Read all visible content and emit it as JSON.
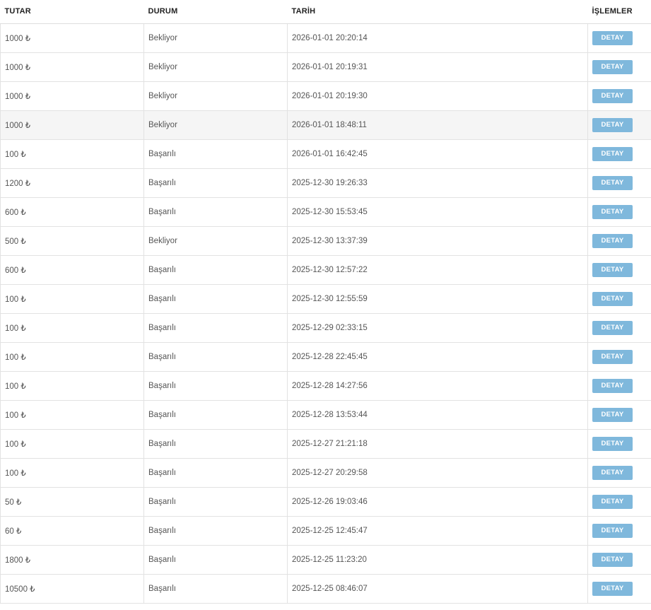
{
  "table": {
    "headers": [
      "TUTAR",
      "DURUM",
      "TARİH",
      "İŞLEMLER"
    ],
    "action_label": "DETAY",
    "highlighted_row": 3,
    "rows": [
      {
        "amount": "1000 ₺",
        "status": "Bekliyor",
        "date": "2026-01-01 20:20:14"
      },
      {
        "amount": "1000 ₺",
        "status": "Bekliyor",
        "date": "2026-01-01 20:19:31"
      },
      {
        "amount": "1000 ₺",
        "status": "Bekliyor",
        "date": "2026-01-01 20:19:30"
      },
      {
        "amount": "1000 ₺",
        "status": "Bekliyor",
        "date": "2026-01-01 18:48:11"
      },
      {
        "amount": "100 ₺",
        "status": "Başarılı",
        "date": "2026-01-01 16:42:45"
      },
      {
        "amount": "1200 ₺",
        "status": "Başarılı",
        "date": "2025-12-30 19:26:33"
      },
      {
        "amount": "600 ₺",
        "status": "Başarılı",
        "date": "2025-12-30 15:53:45"
      },
      {
        "amount": "500 ₺",
        "status": "Bekliyor",
        "date": "2025-12-30 13:37:39"
      },
      {
        "amount": "600 ₺",
        "status": "Başarılı",
        "date": "2025-12-30 12:57:22"
      },
      {
        "amount": "100 ₺",
        "status": "Başarılı",
        "date": "2025-12-30 12:55:59"
      },
      {
        "amount": "100 ₺",
        "status": "Başarılı",
        "date": "2025-12-29 02:33:15"
      },
      {
        "amount": "100 ₺",
        "status": "Başarılı",
        "date": "2025-12-28 22:45:45"
      },
      {
        "amount": "100 ₺",
        "status": "Başarılı",
        "date": "2025-12-28 14:27:56"
      },
      {
        "amount": "100 ₺",
        "status": "Başarılı",
        "date": "2025-12-28 13:53:44"
      },
      {
        "amount": "100 ₺",
        "status": "Başarılı",
        "date": "2025-12-27 21:21:18"
      },
      {
        "amount": "100 ₺",
        "status": "Başarılı",
        "date": "2025-12-27 20:29:58"
      },
      {
        "amount": "50 ₺",
        "status": "Başarılı",
        "date": "2025-12-26 19:03:46"
      },
      {
        "amount": "60 ₺",
        "status": "Başarılı",
        "date": "2025-12-25 12:45:47"
      },
      {
        "amount": "1800 ₺",
        "status": "Başarılı",
        "date": "2025-12-25 11:23:20"
      },
      {
        "amount": "10500 ₺",
        "status": "Başarılı",
        "date": "2025-12-25 08:46:07"
      }
    ]
  },
  "colors": {
    "button_bg": "#7fb8dc",
    "button_text": "#ffffff",
    "border": "#e2e2e2",
    "row_hover": "#f5f5f5"
  }
}
